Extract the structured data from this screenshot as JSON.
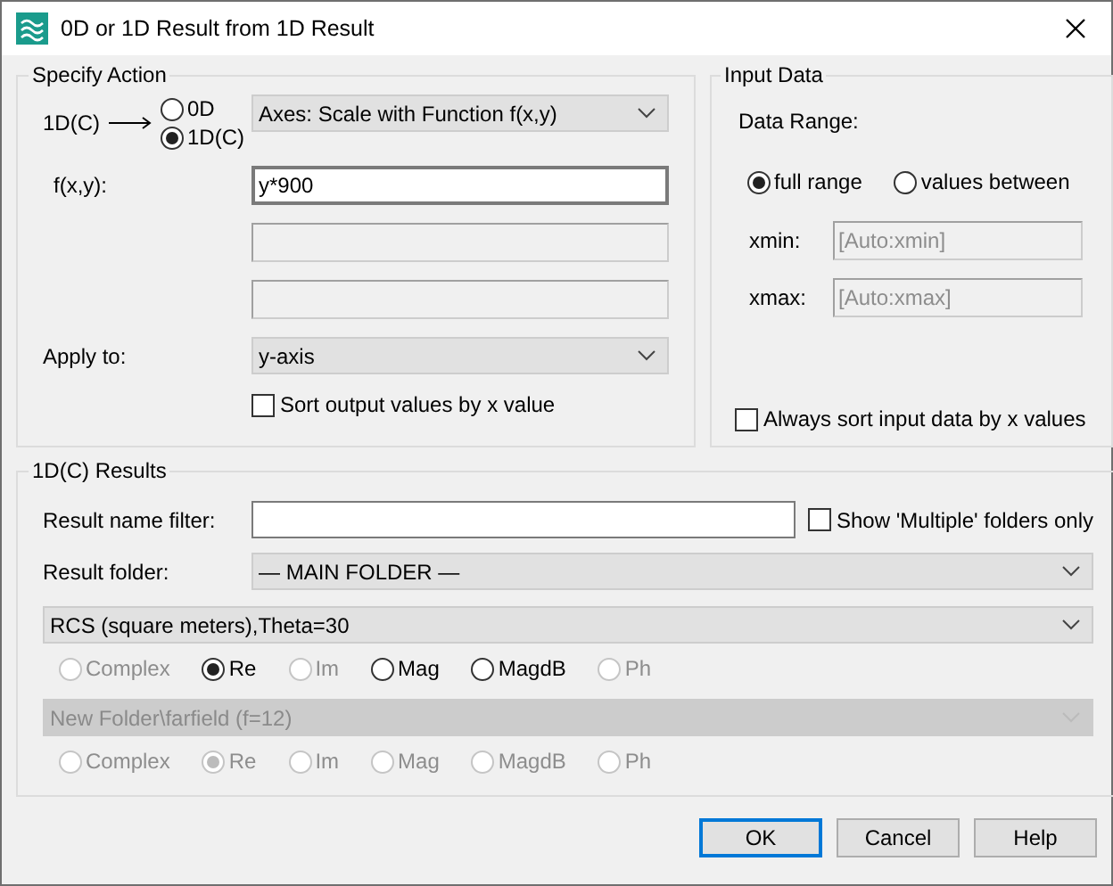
{
  "window": {
    "title": "0D or 1D Result from 1D Result"
  },
  "specify_action": {
    "title": "Specify Action",
    "source_label": "1D(C)",
    "output_types": [
      {
        "label": "0D",
        "selected": false
      },
      {
        "label": "1D(C)",
        "selected": true
      }
    ],
    "action": "Axes: Scale with Function f(x,y)",
    "function_label": "f(x,y):",
    "function_value": "y*900",
    "extra_fields": [
      {
        "disabled": true
      },
      {
        "disabled": true
      }
    ],
    "apply_to_label": "Apply to:",
    "apply_to": "y-axis",
    "sort_output": {
      "label": "Sort output values by x value",
      "checked": false
    }
  },
  "input_data": {
    "title": "Input Data",
    "data_range_label": "Data Range:",
    "ranges": [
      {
        "label": "full range",
        "selected": true
      },
      {
        "label": "values between",
        "selected": false
      }
    ],
    "limits": [
      {
        "label": "xmin:",
        "value": "[Auto:xmin]",
        "disabled": true
      },
      {
        "label": "xmax:",
        "value": "[Auto:xmax]",
        "disabled": true
      }
    ],
    "sort_input": {
      "label": "Always sort input data by x values",
      "checked": false
    }
  },
  "results": {
    "title": "1D(C) Results",
    "filter_label": "Result name filter:",
    "show_multiple": {
      "label": "Show 'Multiple' folders only",
      "checked": false
    },
    "folder_label": "Result folder:",
    "folder": "— MAIN FOLDER —",
    "selections": [
      {
        "result": "RCS (square meters),Theta=30",
        "disabled": false,
        "components": [
          {
            "label": "Complex",
            "selected": false,
            "disabled": true
          },
          {
            "label": "Re",
            "selected": true,
            "disabled": false
          },
          {
            "label": "Im",
            "selected": false,
            "disabled": true
          },
          {
            "label": "Mag",
            "selected": false,
            "disabled": false
          },
          {
            "label": "MagdB",
            "selected": false,
            "disabled": false
          },
          {
            "label": "Ph",
            "selected": false,
            "disabled": true
          }
        ]
      },
      {
        "result": "New Folder\\farfield (f=12)",
        "disabled": true,
        "components": [
          {
            "label": "Complex",
            "selected": false,
            "disabled": true
          },
          {
            "label": "Re",
            "selected": true,
            "disabled": true
          },
          {
            "label": "Im",
            "selected": false,
            "disabled": true
          },
          {
            "label": "Mag",
            "selected": false,
            "disabled": true
          },
          {
            "label": "MagdB",
            "selected": false,
            "disabled": true
          },
          {
            "label": "Ph",
            "selected": false,
            "disabled": true
          }
        ]
      }
    ]
  },
  "buttons": [
    {
      "label": "OK",
      "default": true
    },
    {
      "label": "Cancel",
      "default": false
    },
    {
      "label": "Help",
      "default": false
    }
  ]
}
